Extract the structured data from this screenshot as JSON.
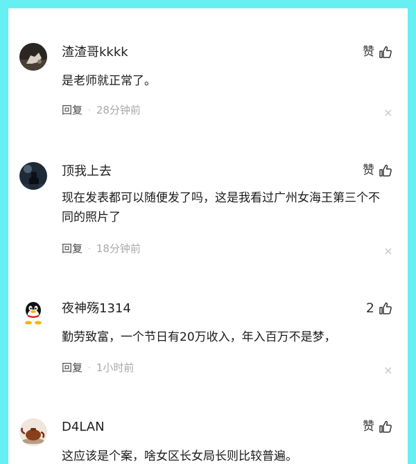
{
  "colors": {
    "frame": "#66f0f4",
    "panel": "#ffffff",
    "meta_text": "#a8a8a8"
  },
  "comments": [
    {
      "username": "渣渣哥kkkk",
      "like_label": "赞",
      "text": "是老师就正常了。",
      "reply_label": "回复",
      "separator": "·",
      "time": "28分钟前",
      "close_glyph": "×",
      "avatar_icon": "hand-photo-avatar"
    },
    {
      "username": "顶我上去",
      "like_label": "赞",
      "text": "现在发表都可以随便发了吗，这是我看过广州女海王第三个不同的照片了",
      "reply_label": "回复",
      "separator": "·",
      "time": "18分钟前",
      "close_glyph": "×",
      "avatar_icon": "night-figure-avatar"
    },
    {
      "username": "夜神殇1314",
      "like_label": "2",
      "text": "勤劳致富，一个节日有20万收入，年入百万不是梦，",
      "reply_label": "回复",
      "separator": "·",
      "time": "1小时前",
      "close_glyph": "×",
      "avatar_icon": "penguin-avatar"
    },
    {
      "username": "D4LAN",
      "like_label": "赞",
      "text": "这应该是个案，啥女区长女局长则比较普遍。",
      "avatar_icon": "teapot-avatar"
    }
  ]
}
